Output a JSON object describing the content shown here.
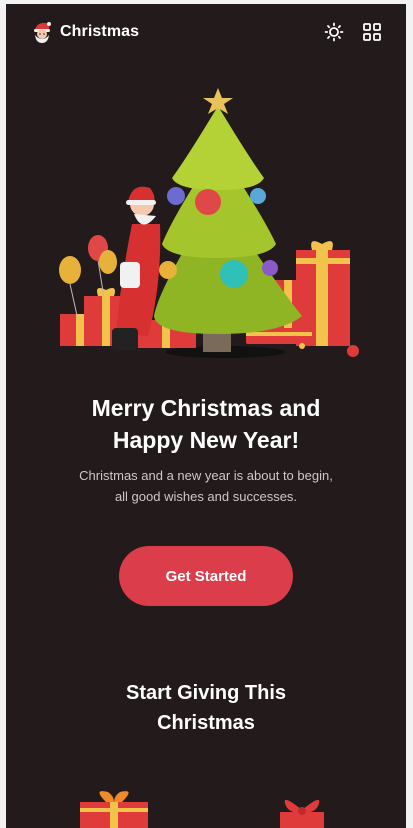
{
  "header": {
    "title": "Christmas",
    "logo_icon": "santa-face-icon",
    "theme_toggle_icon": "sun-icon",
    "menu_icon": "grid-icon"
  },
  "hero": {
    "image": "christmas-tree-santa-gifts-illustration"
  },
  "headline": {
    "line1": "Merry Christmas and",
    "line2": "Happy New Year!"
  },
  "subtext": {
    "line1": "Christmas and a new year is about to begin,",
    "line2": "all good wishes and successes."
  },
  "cta": {
    "label": "Get Started"
  },
  "section": {
    "title_line1": "Start Giving This",
    "title_line2": "Christmas"
  },
  "colors": {
    "background": "#231b1b",
    "accent": "#dc3d4a",
    "text": "#ffffff",
    "muted_text": "#cfc7c7"
  }
}
